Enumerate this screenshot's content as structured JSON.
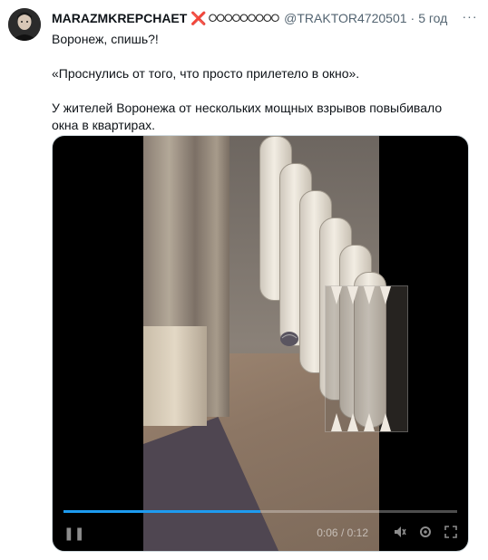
{
  "tweet": {
    "display_name": "MARAZMKREPCHAET",
    "name_emoji": "❌",
    "name_circles": "⭘⭘⭘⭘⭘⭘⭘⭘⭘",
    "handle": "@TRAKTOR4720501",
    "separator": "·",
    "time": "5 год",
    "more_label": "···",
    "text_line1": "Воронеж, спишь?!",
    "text_line2": "«Проснулись от того, что просто прилетело в окно».",
    "text_line3": "У жителей Воронежа от нескольких мощных взрывов повыбивало окна в квартирах."
  },
  "video": {
    "play_icon": "pause-icon",
    "current_time": "0:06",
    "duration": "0:12",
    "time_separator": "/",
    "progress": 0.5,
    "controls": [
      "volume-icon",
      "settings-icon",
      "fullscreen-icon"
    ]
  },
  "colors": {
    "accent": "#1d9bf0",
    "secondary_text": "#536471",
    "primary_text": "#0f1419",
    "emoji_red": "#d6293e"
  }
}
